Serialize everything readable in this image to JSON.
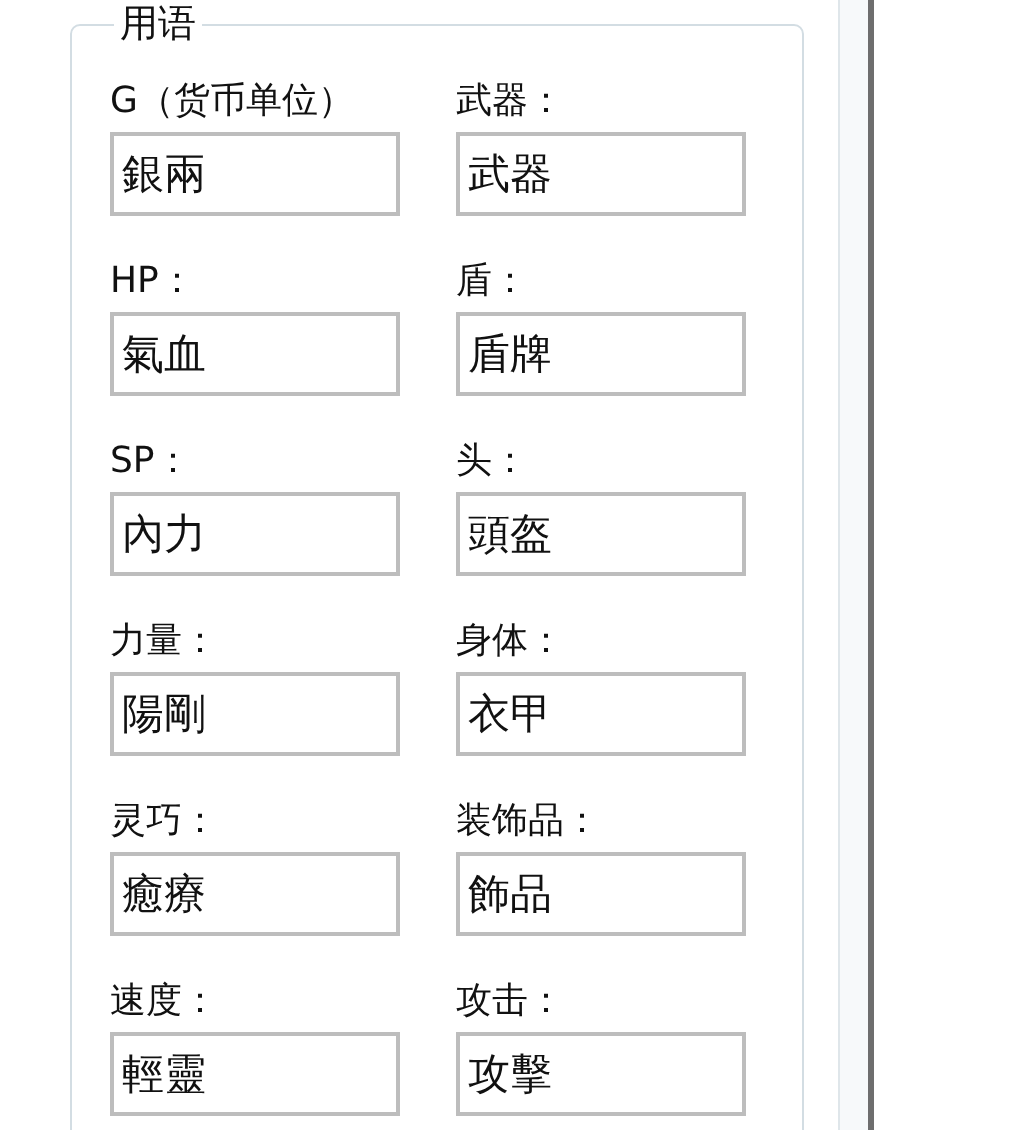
{
  "group": {
    "title": "用语"
  },
  "terms": [
    {
      "label": "G（货币单位）",
      "value": "銀兩"
    },
    {
      "label": "武器：",
      "value": "武器"
    },
    {
      "label": "HP：",
      "value": "氣血"
    },
    {
      "label": "盾：",
      "value": "盾牌"
    },
    {
      "label": "SP：",
      "value": "內力"
    },
    {
      "label": "头：",
      "value": "頭盔"
    },
    {
      "label": "力量：",
      "value": "陽剛"
    },
    {
      "label": "身体：",
      "value": "衣甲"
    },
    {
      "label": "灵巧：",
      "value": "癒療"
    },
    {
      "label": "装饰品：",
      "value": "飾品"
    },
    {
      "label": "速度：",
      "value": "輕靈"
    },
    {
      "label": "攻击：",
      "value": "攻擊"
    }
  ]
}
